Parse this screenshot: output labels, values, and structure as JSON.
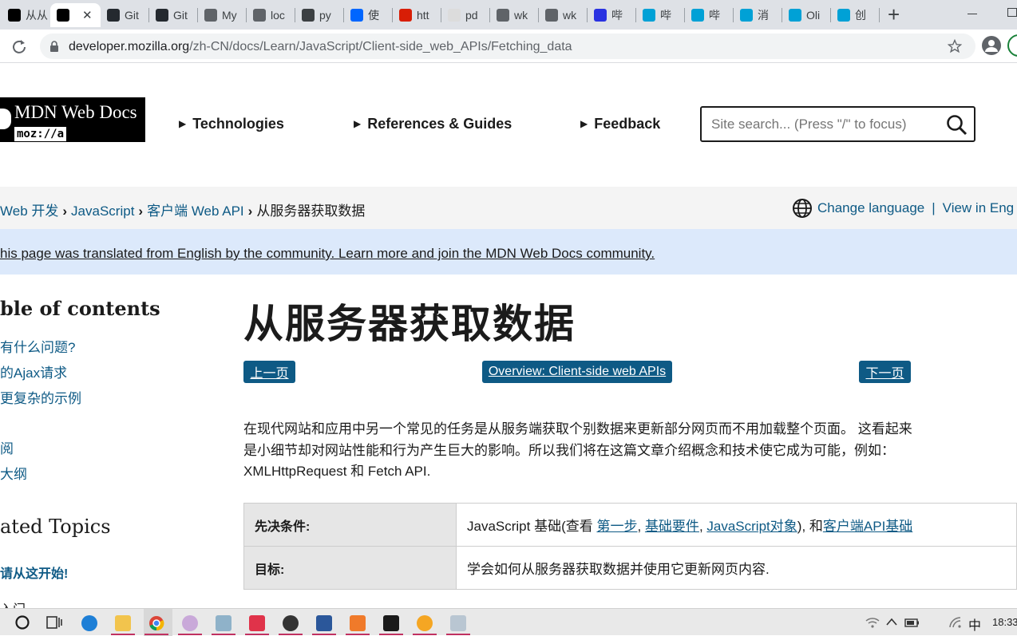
{
  "browser": {
    "tabs": [
      {
        "title": "从从",
        "icon": "mdn-icon",
        "color": "#000000"
      },
      {
        "title": "",
        "icon": "mdn-icon",
        "color": "#000000",
        "active": true
      },
      {
        "title": "Git",
        "icon": "github-icon",
        "color": "#24292f"
      },
      {
        "title": "Git",
        "icon": "github-icon",
        "color": "#24292f"
      },
      {
        "title": "My",
        "icon": "globe-icon",
        "color": "#5f6368"
      },
      {
        "title": "loc",
        "icon": "globe-icon",
        "color": "#5f6368"
      },
      {
        "title": "py",
        "icon": "python-icon",
        "color": "#3c4043"
      },
      {
        "title": "使",
        "icon": "zhihu-icon",
        "color": "#0066ff"
      },
      {
        "title": "htt",
        "icon": "five-icon",
        "color": "#d81e06"
      },
      {
        "title": "pd",
        "icon": "doc-icon",
        "color": "#dcdcdc"
      },
      {
        "title": "wk",
        "icon": "globe-icon",
        "color": "#5f6368"
      },
      {
        "title": "wk",
        "icon": "globe-icon",
        "color": "#5f6368"
      },
      {
        "title": "哔",
        "icon": "baidu-icon",
        "color": "#2932e1"
      },
      {
        "title": "哔",
        "icon": "bilibili-icon",
        "color": "#00a1d6"
      },
      {
        "title": "哔",
        "icon": "bilibili-icon",
        "color": "#00a1d6"
      },
      {
        "title": "消",
        "icon": "bilibili-icon",
        "color": "#00a1d6"
      },
      {
        "title": "Oli",
        "icon": "bilibili-icon",
        "color": "#00a1d6"
      },
      {
        "title": "创",
        "icon": "bilibili-icon",
        "color": "#00a1d6"
      }
    ],
    "new_tab_label": "+",
    "close_tab_label": "✕",
    "url_host": "developer.mozilla.org",
    "url_path": "/zh-CN/docs/Learn/JavaScript/Client-side_web_APIs/Fetching_data"
  },
  "header": {
    "logo_line1": "MDN Web Docs",
    "logo_line2": "moz://a",
    "nav": [
      "Technologies",
      "References & Guides",
      "Feedback"
    ],
    "search_placeholder": "Site search... (Press \"/\" to focus)"
  },
  "breadcrumbs": {
    "items": [
      "Web 开发",
      "JavaScript",
      "客户端 Web API"
    ],
    "current": "从服务器获取数据",
    "change_language": "Change language",
    "separator": "|",
    "view_in_english": "View in Eng"
  },
  "notice": "his page was translated from English by the community. Learn more and join the MDN Web Docs community.",
  "sidebar": {
    "toc_title": "ble of contents",
    "toc_items": [
      "有什么问题?",
      "的Ajax请求",
      "更复杂的示例",
      "阅",
      "大纲"
    ],
    "related_title": "ated Topics",
    "related_first": "请从这开始!",
    "related_next": "入门"
  },
  "main": {
    "title": "从服务器获取数据",
    "prev_label": "上一页",
    "overview_label": "Overview: Client-side web APIs",
    "next_label": "下一页",
    "intro": "在现代网站和应用中另一个常见的任务是从服务端获取个别数据来更新部分网页而不用加载整个页面。 这看起来是小细节却对网站性能和行为产生巨大的影响。所以我们将在这篇文章介绍概念和技术使它成为可能，例如： XMLHttpRequest 和 Fetch API.",
    "prereq_label": "先决条件:",
    "prereq_text_before": "JavaScript 基础(查看 ",
    "prereq_links": [
      "第一步",
      "基础要件",
      "JavaScript对象"
    ],
    "prereq_and": ", 和",
    "prereq_last_link": "客户端API基础",
    "goal_label": "目标:",
    "goal_text": "学会如何从服务器获取数据并使用它更新网页内容."
  },
  "taskbar": {
    "time": "18:33",
    "ime": "中"
  },
  "colors": {
    "link": "#0e5a85",
    "notice_bg": "#dce9fb",
    "breadcrumb_bg": "#f4f4f4",
    "button_bg": "#0e5a85"
  }
}
